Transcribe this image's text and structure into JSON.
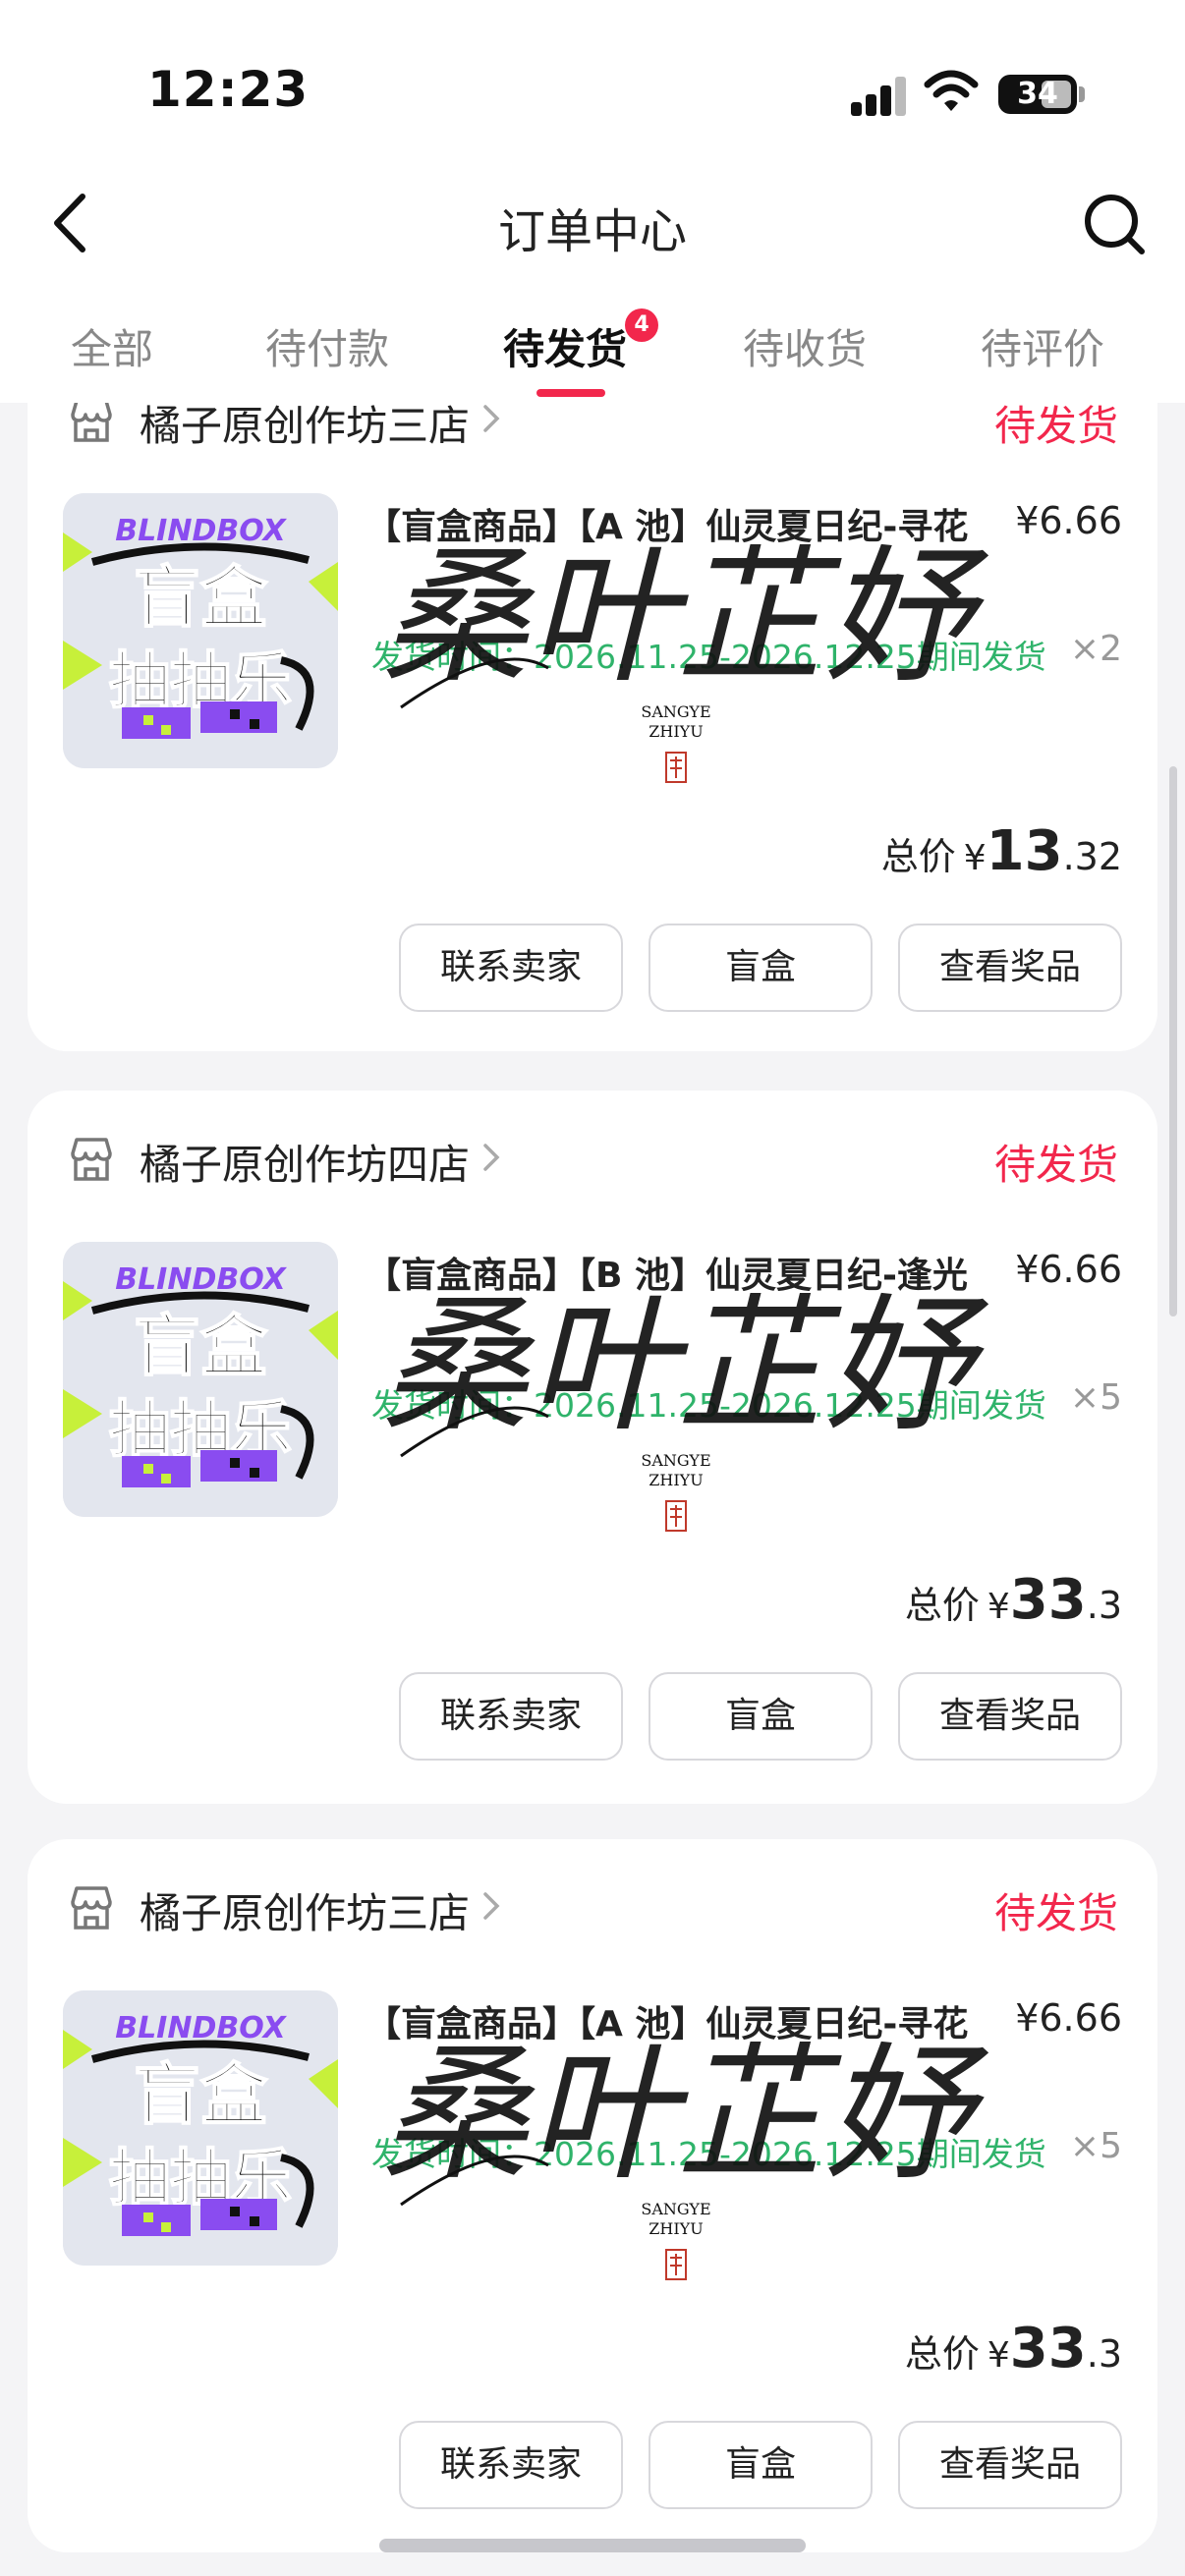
{
  "status_bar": {
    "time": "12:23",
    "battery": "34"
  },
  "nav": {
    "title": "订单中心"
  },
  "tabs": [
    {
      "label": "全部"
    },
    {
      "label": "待付款"
    },
    {
      "label": "待发货",
      "badge": "4"
    },
    {
      "label": "待收货"
    },
    {
      "label": "待评价"
    }
  ],
  "orders": [
    {
      "shop": "橘子原创作坊三店",
      "status": "待发货",
      "title": "【盲盒商品】【A 池】仙灵夏日纪-寻花",
      "price": "¥6.66",
      "ship_time": "发货时间：2026.11.25-2026.12.25期间发货",
      "qty": "×2",
      "total_label": "总价",
      "total_currency": "¥",
      "total_int": "13",
      "total_dec": ".32",
      "buttons": [
        "联系卖家",
        "盲盒",
        "查看奖品"
      ]
    },
    {
      "shop": "橘子原创作坊四店",
      "status": "待发货",
      "title": "【盲盒商品】【B 池】仙灵夏日纪-逢光",
      "price": "¥6.66",
      "ship_time": "发货时间：2026.11.25-2026.12.25期间发货",
      "qty": "×5",
      "total_label": "总价",
      "total_currency": "¥",
      "total_int": "33",
      "total_dec": ".3",
      "buttons": [
        "联系卖家",
        "盲盒",
        "查看奖品"
      ]
    },
    {
      "shop": "橘子原创作坊三店",
      "status": "待发货",
      "title": "【盲盒商品】【A 池】仙灵夏日纪-寻花",
      "price": "¥6.66",
      "ship_time": "发货时间：2026.11.25-2026.12.25期间发货",
      "qty": "×5",
      "total_label": "总价",
      "total_currency": "¥",
      "total_int": "33",
      "total_dec": ".3",
      "buttons": [
        "联系卖家",
        "盲盒",
        "查看奖品"
      ]
    }
  ],
  "product_image": {
    "brand": "BLINDBOX",
    "line1": "盲盒",
    "line2": "抽抽乐"
  },
  "watermark": {
    "calligraphy": "桑叶芷妤",
    "latin1": "SANGYE",
    "latin2": "ZHIYU"
  },
  "colors": {
    "accent": "#f2274c",
    "ship_green": "#2fb36a",
    "brand_purple": "#8a4cf0"
  }
}
